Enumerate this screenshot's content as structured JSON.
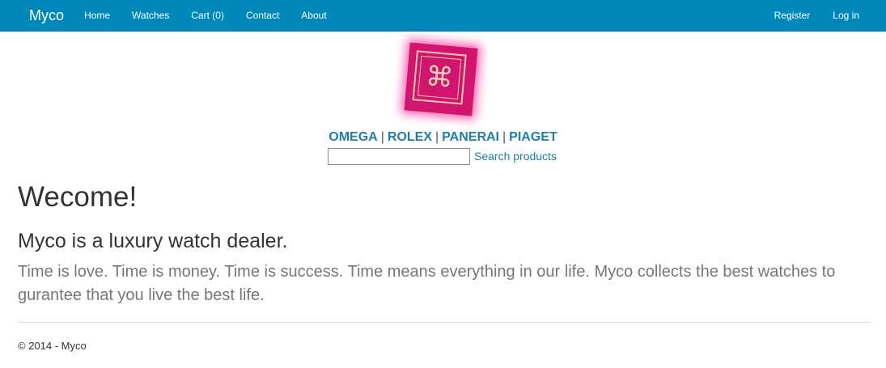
{
  "navbar": {
    "brand": "Myco",
    "links": [
      "Home",
      "Watches",
      "Cart (0)",
      "Contact",
      "About"
    ],
    "right_links": [
      "Register",
      "Log in"
    ],
    "color": "#0088bb"
  },
  "logo": {
    "icon": "command-key-icon",
    "glyph": "⌘",
    "color": "#d1146e"
  },
  "brands": {
    "items": [
      "OMEGA",
      "ROLEX",
      "PANERAI",
      "PIAGET"
    ],
    "separator": "|"
  },
  "search": {
    "value": "",
    "link_label": "Search products"
  },
  "main": {
    "heading": "Wecome!",
    "subheading": "Myco is a luxury watch dealer.",
    "lead": "Time is love. Time is money. Time is success. Time means everything in our life. Myco collects the best watches to gurantee that you live the best life."
  },
  "footer": {
    "text": "© 2014 - Myco"
  }
}
